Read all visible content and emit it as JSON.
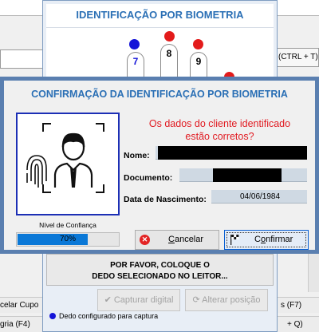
{
  "background": {
    "right_button_label": "(CTRL + T)",
    "footer_rows": [
      {
        "label": "celar Cupo"
      },
      {
        "label": "gria (F4)"
      },
      {
        "label": "s (F7)"
      },
      {
        "label": "+ Q)"
      }
    ]
  },
  "capture_window": {
    "title": "IDENTIFICAÇÃO POR BIOMETRIA",
    "fingers": [
      "7",
      "8",
      "9"
    ],
    "message_line1": "POR FAVOR, COLOQUE O",
    "message_line2": "DEDO SELECIONADO NO LEITOR...",
    "capture_button": "Capturar digital",
    "capture_button_hotkey": "C",
    "change_position_button": "Alterar posição",
    "change_position_hotkey": "A",
    "legend": "Dedo configurado para captura",
    "colors": {
      "selected_dot": "#e31b1b",
      "configured_dot": "#1414d8"
    }
  },
  "dialog": {
    "title": "CONFIRMAÇÃO DA IDENTIFICAÇÃO POR BIOMETRIA",
    "question_line1": "Os dados do cliente identificado",
    "question_line2": "estão corretos?",
    "confidence_label": "Nível de Confiança",
    "confidence_percent": 70,
    "confidence_text": "70%",
    "fields": {
      "name_label": "Nome:",
      "document_label": "Documento:",
      "birth_label": "Data de Nascimento:",
      "birth_value": "04/06/1984"
    },
    "cancel_button": "Cancelar",
    "cancel_hotkey": "C",
    "confirm_button": "Confirmar",
    "confirm_hotkey": "o",
    "colors": {
      "title": "#2a6fb5",
      "question": "#e11b22",
      "confidence_fill": "#0a78d7",
      "photo_border": "#1c2fb5"
    }
  }
}
